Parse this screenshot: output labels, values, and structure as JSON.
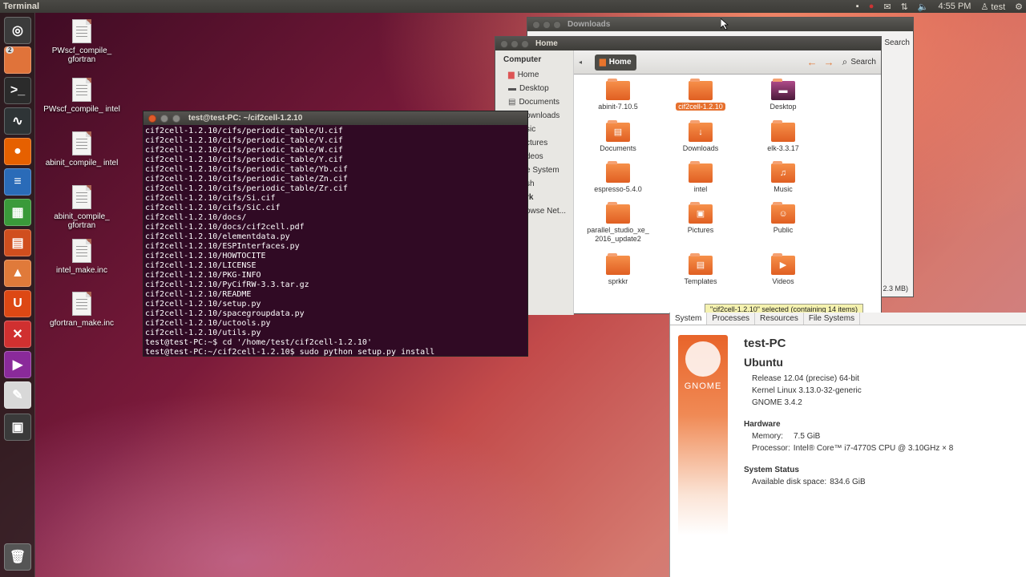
{
  "topbar": {
    "app_title": "Terminal",
    "clock": "4:55 PM",
    "user": "test"
  },
  "launcher": {
    "items": [
      {
        "name": "ubuntu-dash-icon",
        "glyph": "◎",
        "color": "#3b3b3b"
      },
      {
        "name": "files-icon",
        "glyph": "",
        "color": "#e0733a",
        "badge": "2"
      },
      {
        "name": "terminal-icon",
        "glyph": ">_",
        "color": "#2b2b2b"
      },
      {
        "name": "system-monitor-icon",
        "glyph": "∿",
        "color": "#2e3436"
      },
      {
        "name": "firefox-icon",
        "glyph": "●",
        "color": "#e66000"
      },
      {
        "name": "writer-icon",
        "glyph": "≡",
        "color": "#2a6bb8"
      },
      {
        "name": "calc-icon",
        "glyph": "▦",
        "color": "#3a9a3a"
      },
      {
        "name": "impress-icon",
        "glyph": "▤",
        "color": "#d04e1e"
      },
      {
        "name": "software-center-icon",
        "glyph": "▲",
        "color": "#e07a3a"
      },
      {
        "name": "ubuntu-one-icon",
        "glyph": "U",
        "color": "#dd4814"
      },
      {
        "name": "settings-icon",
        "glyph": "✕",
        "color": "#d03030"
      },
      {
        "name": "video-icon",
        "glyph": "▶",
        "color": "#8a2a9a"
      },
      {
        "name": "text-editor-icon",
        "glyph": "✎",
        "color": "#d8d8d8"
      },
      {
        "name": "workspace-switcher-icon",
        "glyph": "▣",
        "color": "#3a3a3a"
      },
      {
        "name": "trash-icon",
        "glyph": "🗑",
        "color": "#555"
      }
    ]
  },
  "desktop": {
    "icons": [
      {
        "label": "PWscf_compile_ gfortran"
      },
      {
        "label": "PWscf_compile_ intel"
      },
      {
        "label": "abinit_compile_ intel"
      },
      {
        "label": "abinit_compile_ gfortran"
      },
      {
        "label": "intel_make.inc"
      },
      {
        "label": "gfortran_make.inc"
      }
    ]
  },
  "terminal": {
    "title": "test@test-PC: ~/cif2cell-1.2.10",
    "lines": [
      "cif2cell-1.2.10/cifs/periodic_table/U.cif",
      "cif2cell-1.2.10/cifs/periodic_table/V.cif",
      "cif2cell-1.2.10/cifs/periodic_table/W.cif",
      "cif2cell-1.2.10/cifs/periodic_table/Y.cif",
      "cif2cell-1.2.10/cifs/periodic_table/Yb.cif",
      "cif2cell-1.2.10/cifs/periodic_table/Zn.cif",
      "cif2cell-1.2.10/cifs/periodic_table/Zr.cif",
      "cif2cell-1.2.10/cifs/Si.cif",
      "cif2cell-1.2.10/cifs/SiC.cif",
      "cif2cell-1.2.10/docs/",
      "cif2cell-1.2.10/docs/cif2cell.pdf",
      "cif2cell-1.2.10/elementdata.py",
      "cif2cell-1.2.10/ESPInterfaces.py",
      "cif2cell-1.2.10/HOWTOCITE",
      "cif2cell-1.2.10/LICENSE",
      "cif2cell-1.2.10/PKG-INFO",
      "cif2cell-1.2.10/PyCifRW-3.3.tar.gz",
      "cif2cell-1.2.10/README",
      "cif2cell-1.2.10/setup.py",
      "cif2cell-1.2.10/spacegroupdata.py",
      "cif2cell-1.2.10/uctools.py",
      "cif2cell-1.2.10/utils.py",
      "test@test-PC:~$ cd '/home/test/cif2cell-1.2.10'",
      "test@test-PC:~/cif2cell-1.2.10$ sudo python setup.py install"
    ]
  },
  "downloads_window": {
    "title": "Downloads",
    "search": "Search",
    "status": "2.3 MB)"
  },
  "nautilus": {
    "title": "Home",
    "search": "Search",
    "crumb": "Home",
    "sidebar": {
      "header": "Computer",
      "items": [
        "Home",
        "Desktop",
        "Documents",
        "ownloads",
        "sic",
        "ctures",
        "deos",
        "e System",
        "sh"
      ],
      "network_header": "rk",
      "network_item": "owse Net..."
    },
    "files": [
      {
        "label": "abinit-7.10.5",
        "glyph": ""
      },
      {
        "label": "cif2cell-1.2.10",
        "glyph": "",
        "selected": true
      },
      {
        "label": "Desktop",
        "glyph": "▬"
      },
      {
        "label": "Documents",
        "glyph": "▤"
      },
      {
        "label": "Downloads",
        "glyph": "↓"
      },
      {
        "label": "elk-3.3.17",
        "glyph": ""
      },
      {
        "label": "espresso-5.4.0",
        "glyph": ""
      },
      {
        "label": "intel",
        "glyph": ""
      },
      {
        "label": "Music",
        "glyph": "♫"
      },
      {
        "label": "parallel_studio_xe_ 2016_update2",
        "glyph": ""
      },
      {
        "label": "Pictures",
        "glyph": "▣"
      },
      {
        "label": "Public",
        "glyph": "☺"
      },
      {
        "label": "sprkkr",
        "glyph": ""
      },
      {
        "label": "Templates",
        "glyph": "▤"
      },
      {
        "label": "Videos",
        "glyph": "▶"
      }
    ],
    "tooltip": "\"cif2cell-1.2.10\" selected (containing 14 items)"
  },
  "sysinfo": {
    "tabs": [
      "System",
      "Processes",
      "Resources",
      "File Systems"
    ],
    "logo_text": "GNOME",
    "hostname": "test-PC",
    "distro": "Ubuntu",
    "release": "Release 12.04 (precise) 64-bit",
    "kernel": "Kernel Linux 3.13.0-32-generic",
    "gnome": "GNOME 3.4.2",
    "hardware_header": "Hardware",
    "memory_label": "Memory:",
    "memory_value": "7.5 GiB",
    "processor_label": "Processor:",
    "processor_value": "Intel® Core™ i7-4770S CPU @ 3.10GHz × 8",
    "status_header": "System Status",
    "disk_label": "Available disk space:",
    "disk_value": "834.6 GiB"
  }
}
